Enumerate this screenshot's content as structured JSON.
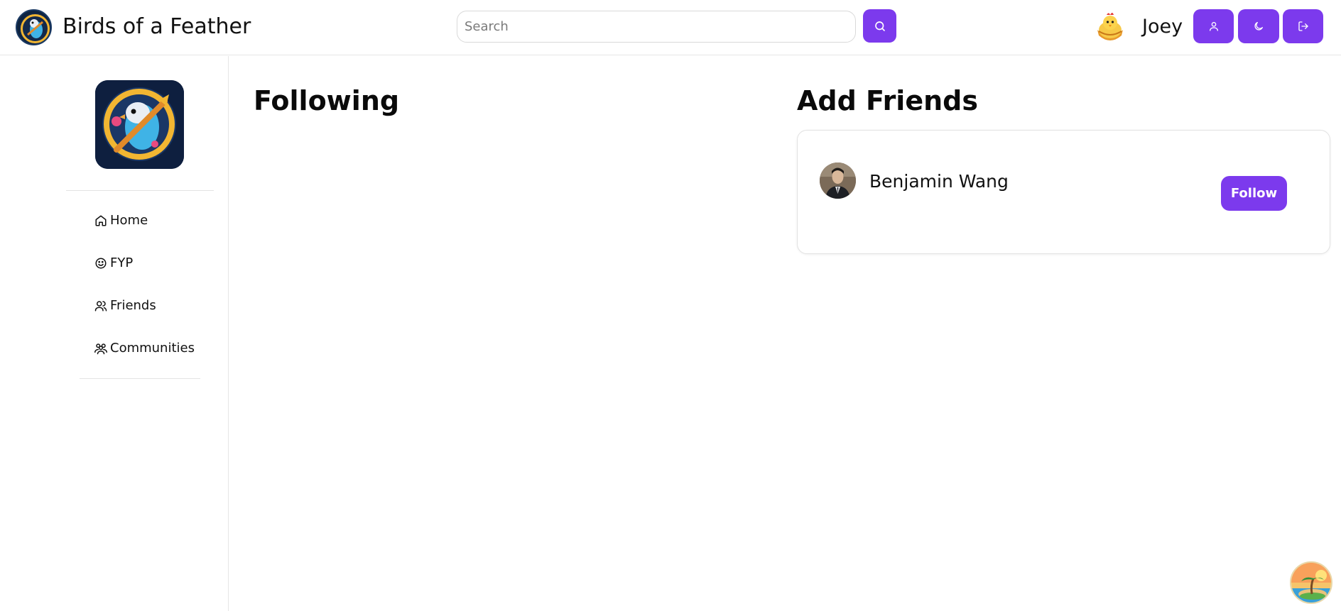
{
  "header": {
    "app_title": "Birds of a Feather",
    "search": {
      "placeholder": "Search",
      "value": ""
    },
    "user": {
      "name": "Joey"
    }
  },
  "sidebar": {
    "items": [
      {
        "label": "Home",
        "icon": "home-icon"
      },
      {
        "label": "FYP",
        "icon": "smile-icon"
      },
      {
        "label": "Friends",
        "icon": "user-icon"
      },
      {
        "label": "Communities",
        "icon": "users-icon"
      }
    ]
  },
  "main": {
    "following": {
      "title": "Following"
    },
    "add_friends": {
      "title": "Add Friends",
      "suggestions": [
        {
          "name": "Benjamin Wang",
          "action_label": "Follow"
        }
      ]
    }
  },
  "colors": {
    "accent": "#7c3aed",
    "border": "#e6e6e6",
    "text": "#111111"
  },
  "icons": {
    "search": "search-icon",
    "profile": "user-icon",
    "theme": "moon-icon",
    "logout": "logout-icon"
  }
}
